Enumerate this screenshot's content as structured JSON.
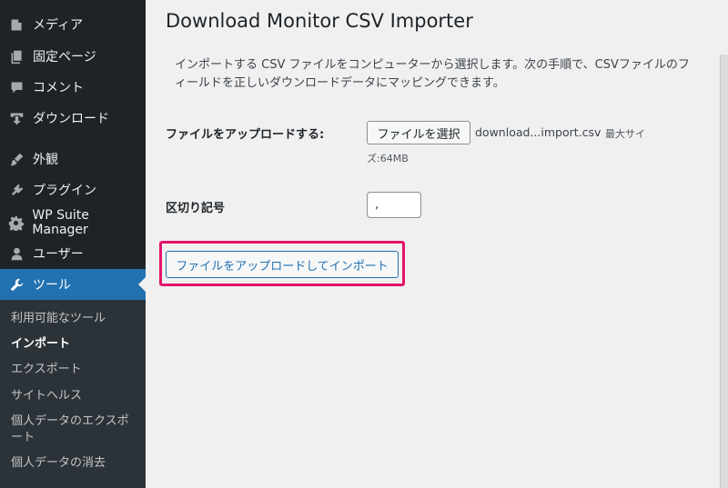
{
  "sidebar": {
    "items": [
      {
        "label": "メディア",
        "icon": "media-icon"
      },
      {
        "label": "固定ページ",
        "icon": "pages-icon"
      },
      {
        "label": "コメント",
        "icon": "comments-icon"
      },
      {
        "label": "ダウンロード",
        "icon": "download-icon"
      },
      {
        "label": "外観",
        "icon": "appearance-brush-icon"
      },
      {
        "label": "プラグイン",
        "icon": "plugin-icon"
      },
      {
        "label": "WP Suite Manager",
        "icon": "gear-icon"
      },
      {
        "label": "ユーザー",
        "icon": "user-icon"
      },
      {
        "label": "ツール",
        "icon": "wrench-icon"
      }
    ],
    "submenu": [
      {
        "label": "利用可能なツール"
      },
      {
        "label": "インポート"
      },
      {
        "label": "エクスポート"
      },
      {
        "label": "サイトヘルス"
      },
      {
        "label": "個人データのエクスポート"
      },
      {
        "label": "個人データの消去"
      }
    ]
  },
  "main": {
    "title": "Download Monitor CSV Importer",
    "intro": "インポートする CSV ファイルをコンピューターから選択します。次の手順で、CSVファイルのフィールドを正しいダウンロードデータにマッピングできます。",
    "upload_label": "ファイルをアップロードする:",
    "file_button": "ファイルを選択",
    "file_name": "download...import.csv",
    "max_size_1": "最大サイ",
    "max_size_2": "ズ:64MB",
    "delimiter_label": "区切り記号",
    "delimiter_value": ",",
    "submit_button": "ファイルをアップロードしてインポート"
  },
  "colors": {
    "sidebar_bg": "#1d2327",
    "submenu_bg": "#2c3338",
    "active_bg": "#2271b1",
    "highlight": "#e3146b"
  }
}
